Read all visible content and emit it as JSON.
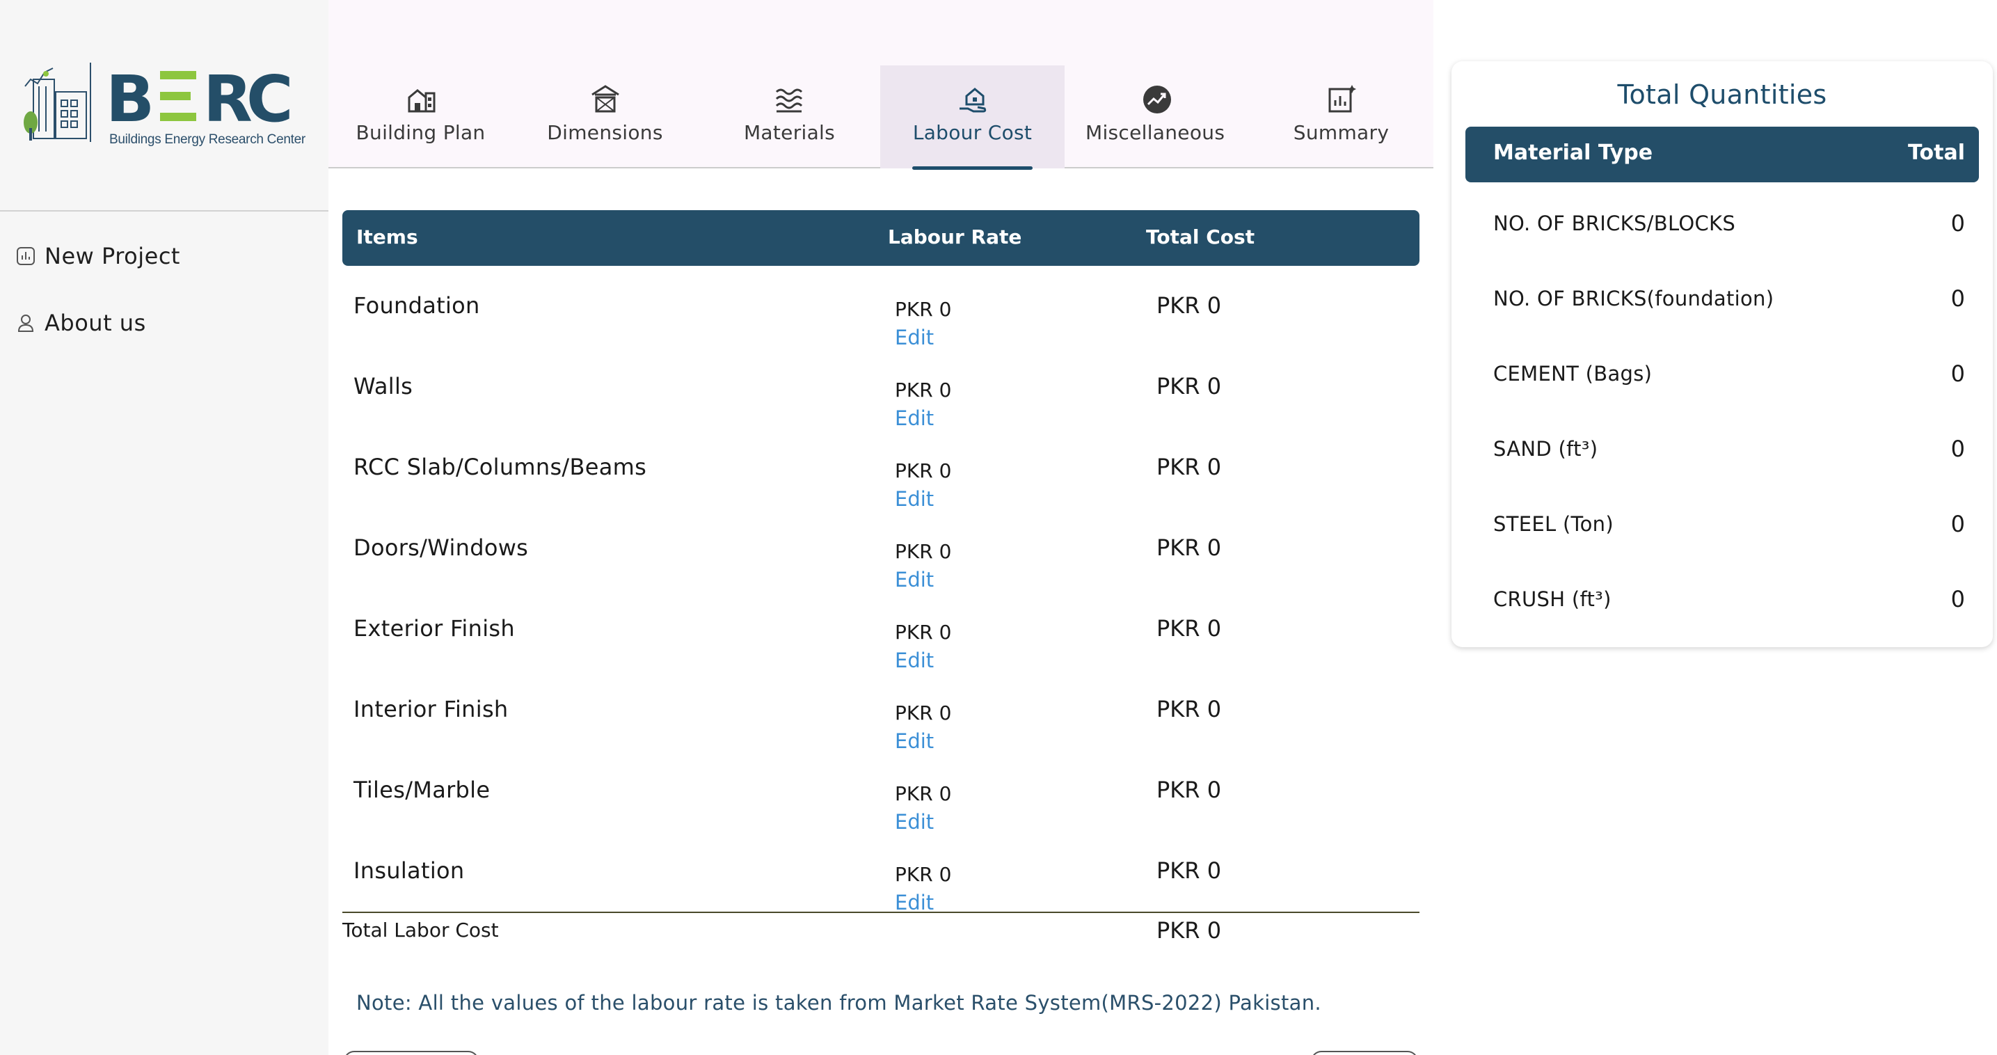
{
  "sidebar": {
    "logo_text": "BERC",
    "logo_subtitle": "Buildings Energy Research Center",
    "items": [
      {
        "label": "New Project",
        "icon": "chart-icon"
      },
      {
        "label": "About us",
        "icon": "user-icon"
      }
    ]
  },
  "tabs": [
    {
      "label": "Building Plan",
      "icon": "building-icon"
    },
    {
      "label": "Dimensions",
      "icon": "house-icon"
    },
    {
      "label": "Materials",
      "icon": "waves-icon"
    },
    {
      "label": "Labour Cost",
      "icon": "hand-house-icon",
      "active": true
    },
    {
      "label": "Miscellaneous",
      "icon": "trend-icon"
    },
    {
      "label": "Summary",
      "icon": "report-icon"
    }
  ],
  "labour_table": {
    "headers": {
      "items": "Items",
      "rate": "Labour Rate",
      "cost": "Total Cost"
    },
    "edit_label": "Edit",
    "rows": [
      {
        "item": "Foundation",
        "rate": "PKR 0",
        "cost": "PKR 0"
      },
      {
        "item": "Walls",
        "rate": "PKR 0",
        "cost": "PKR 0"
      },
      {
        "item": "RCC Slab/Columns/Beams",
        "rate": "PKR 0",
        "cost": "PKR 0"
      },
      {
        "item": "Doors/Windows",
        "rate": "PKR 0",
        "cost": "PKR 0"
      },
      {
        "item": "Exterior Finish",
        "rate": "PKR 0",
        "cost": "PKR 0"
      },
      {
        "item": "Interior Finish",
        "rate": "PKR 0",
        "cost": "PKR 0"
      },
      {
        "item": "Tiles/Marble",
        "rate": "PKR 0",
        "cost": "PKR 0"
      },
      {
        "item": "Insulation",
        "rate": "PKR 0",
        "cost": "PKR 0"
      }
    ],
    "total_label": "Total Labor Cost",
    "total_value": "PKR 0",
    "note": "Note: All the values of the labour rate is taken from Market Rate System(MRS-2022) Pakistan."
  },
  "quantities": {
    "title": "Total Quantities",
    "headers": {
      "type": "Material Type",
      "total": "Total"
    },
    "rows": [
      {
        "name": "NO. OF BRICKS/BLOCKS",
        "value": "0"
      },
      {
        "name": "NO. OF BRICKS(foundation)",
        "value": "0"
      },
      {
        "name": "CEMENT (Bags)",
        "value": "0"
      },
      {
        "name": "SAND (ft³)",
        "value": "0"
      },
      {
        "name": "STEEL (Ton)",
        "value": "0"
      },
      {
        "name": "CRUSH (ft³)",
        "value": "0"
      }
    ]
  },
  "colors": {
    "primary": "#244e68",
    "link": "#3b8fd6",
    "logo_green": "#8dc63f",
    "tab_band": "#fcf7fc"
  }
}
